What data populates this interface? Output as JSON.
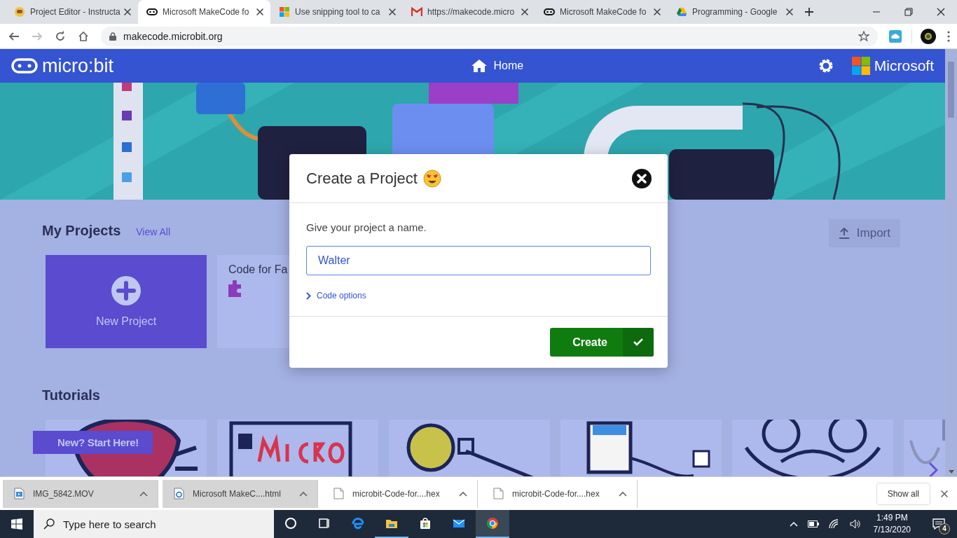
{
  "browser": {
    "tabs": [
      {
        "title": "Project Editor - Instructa",
        "selected": false
      },
      {
        "title": "Microsoft MakeCode fo",
        "selected": true
      },
      {
        "title": "Use snipping tool to ca",
        "selected": false
      },
      {
        "title": "https://makecode.micro",
        "selected": false
      },
      {
        "title": "Microsoft MakeCode fo",
        "selected": false
      },
      {
        "title": "Programming - Google",
        "selected": false
      }
    ],
    "address": "makecode.microbit.org"
  },
  "site": {
    "logo": "micro:bit",
    "nav": "Home",
    "brand": "Microsoft",
    "my_projects": {
      "heading": "My Projects",
      "link": "View All",
      "import_button": "Import",
      "cards": [
        {
          "kind": "new",
          "label": "New Project"
        },
        {
          "kind": "existing",
          "label": "Code for Fa"
        }
      ]
    },
    "tutorials": {
      "heading": "Tutorials",
      "ribbon": "New? Start Here!"
    }
  },
  "dialog": {
    "title": "Create a Project",
    "prompt": "Give your project a name.",
    "name_field": {
      "value": "Walter"
    },
    "options_link": "Code options",
    "create_button": "Create"
  },
  "downloads": {
    "items": [
      {
        "name": "IMG_5842.MOV",
        "kind": "video",
        "highlighted": true
      },
      {
        "name": "Microsoft MakeC....html",
        "kind": "web",
        "highlighted": true
      },
      {
        "name": "microbit-Code-for....hex",
        "kind": "file",
        "highlighted": false
      },
      {
        "name": "microbit-Code-for....hex",
        "kind": "file",
        "highlighted": false
      }
    ],
    "show_all": "Show all"
  },
  "taskbar": {
    "search_placeholder": "Type here to search",
    "apps": [
      {
        "running": false,
        "active": false
      },
      {
        "running": false,
        "active": false
      },
      {
        "running": false,
        "active": false
      },
      {
        "running": true,
        "active": false
      },
      {
        "running": false,
        "active": false
      },
      {
        "running": false,
        "active": false
      },
      {
        "running": true,
        "active": true
      }
    ],
    "time": "1:49 PM",
    "date": "7/13/2020",
    "notifications": "4"
  }
}
